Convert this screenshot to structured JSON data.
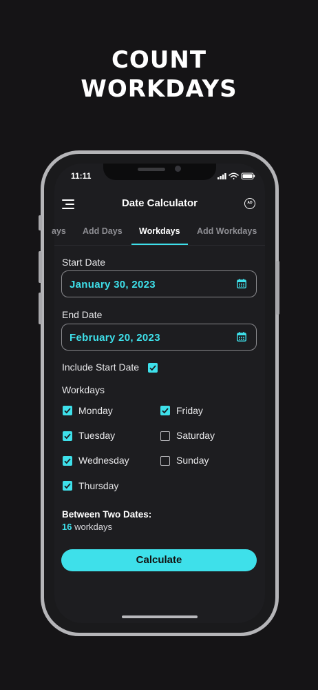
{
  "headline": {
    "line1": "COUNT",
    "line2": "WORKDAYS"
  },
  "status_bar": {
    "time": "11:11"
  },
  "app_bar": {
    "title": "Date Calculator",
    "ad_label": "AD"
  },
  "tabs": [
    {
      "label": "ays"
    },
    {
      "label": "Add Days"
    },
    {
      "label": "Workdays",
      "active": true
    },
    {
      "label": "Add Workdays"
    }
  ],
  "start_date": {
    "label": "Start Date",
    "value": "January 30, 2023"
  },
  "end_date": {
    "label": "End Date",
    "value": "February 20, 2023"
  },
  "include_start": {
    "label": "Include Start Date",
    "checked": true
  },
  "workdays": {
    "label": "Workdays",
    "days": [
      {
        "label": "Monday",
        "checked": true
      },
      {
        "label": "Tuesday",
        "checked": true
      },
      {
        "label": "Wednesday",
        "checked": true
      },
      {
        "label": "Thursday",
        "checked": true
      },
      {
        "label": "Friday",
        "checked": true
      },
      {
        "label": "Saturday",
        "checked": false
      },
      {
        "label": "Sunday",
        "checked": false
      }
    ]
  },
  "result": {
    "title": "Between Two Dates:",
    "count": "16",
    "unit": "workdays"
  },
  "calculate_button": {
    "label": "Calculate"
  },
  "colors": {
    "accent": "#3ee0ea",
    "background": "#151416",
    "screen": "#1d1d20"
  }
}
